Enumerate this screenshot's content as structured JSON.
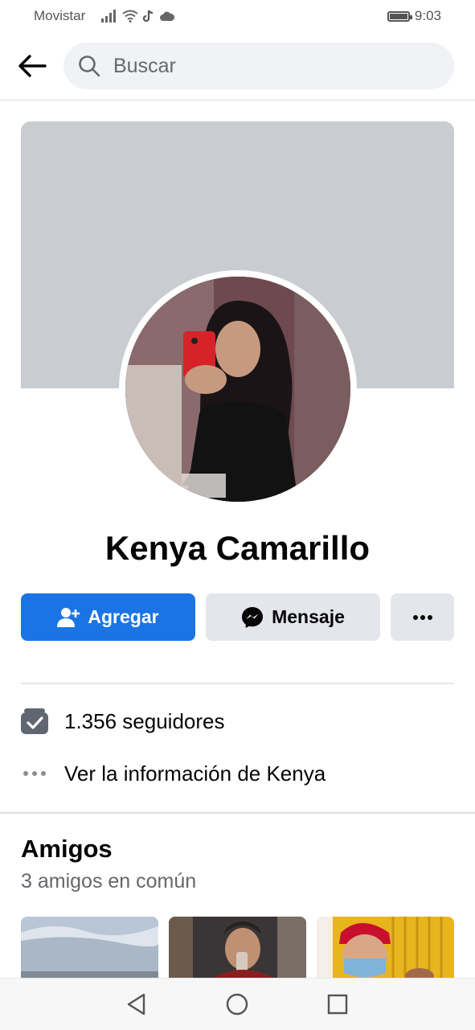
{
  "status_bar": {
    "carrier": "Movistar",
    "time": "9:03",
    "icons": [
      "signal-icon",
      "wifi-icon",
      "tiktok-icon",
      "cloud-icon",
      "battery-icon"
    ]
  },
  "header": {
    "back_icon": "arrow-left-icon",
    "search_placeholder": "Buscar",
    "search_icon": "search-icon"
  },
  "profile": {
    "name": "Kenya Camarillo",
    "cover_color": "#c9ccd1"
  },
  "actions": {
    "add_label": "Agregar",
    "add_icon": "add-friend-icon",
    "message_label": "Mensaje",
    "message_icon": "messenger-icon",
    "more_icon": "more-dots-icon",
    "primary_color": "#1b74e4"
  },
  "info": {
    "followers": "1.356 seguidores",
    "followers_icon": "followers-icon",
    "about": "Ver la información de Kenya",
    "about_icon": "dots-icon"
  },
  "friends": {
    "title": "Amigos",
    "subtitle": "3 amigos en común",
    "photos": [
      "friend-photo-1",
      "friend-photo-2",
      "friend-photo-3"
    ]
  },
  "nav": {
    "icons": [
      "back-triangle-icon",
      "home-circle-icon",
      "recents-square-icon"
    ]
  }
}
